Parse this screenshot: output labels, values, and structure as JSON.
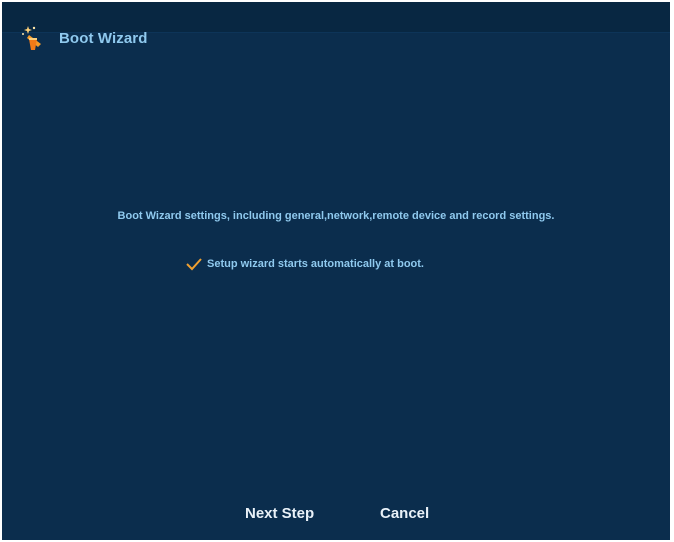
{
  "window": {
    "title": "Boot Wizard",
    "icon": "wizard-wand-icon"
  },
  "main": {
    "description": "Boot Wizard settings, including general,network,remote device and record settings.",
    "auto_start": {
      "checked": true,
      "label": "Setup wizard starts automatically at boot."
    }
  },
  "footer": {
    "next_label": "Next Step",
    "cancel_label": "Cancel"
  },
  "colors": {
    "background": "#0b2d4d",
    "text": "#8fc9ee",
    "accent": "#f0a030",
    "button_text": "#e9f1f8"
  }
}
